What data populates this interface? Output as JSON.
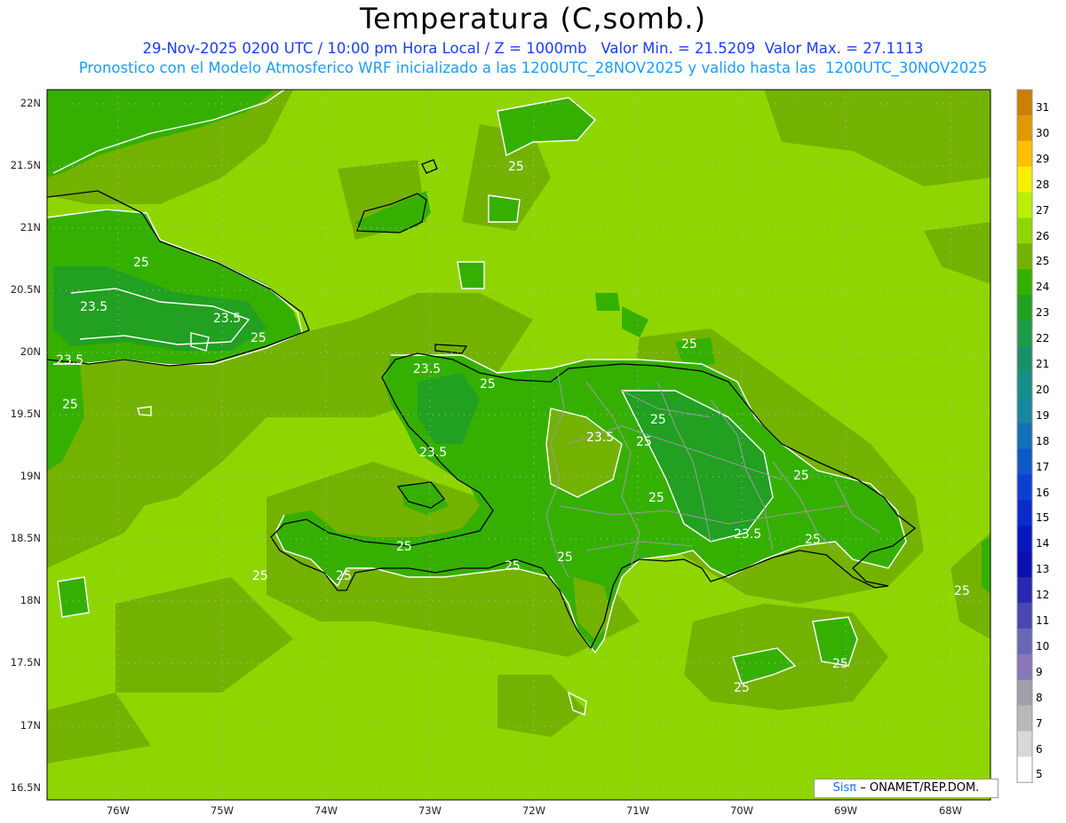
{
  "header": {
    "title": "Temperatura (C,somb.)",
    "line1": "29-Nov-2025 0200 UTC / 10:00 pm Hora Local / Z = 1000mb   Valor Min. = 21.5209  Valor Max. = 27.1113",
    "line2": "Pronostico con el Modelo Atmosferico WRF inicializado a las 1200UTC_28NOV2025 y valido hasta las  1200UTC_30NOV2025"
  },
  "axes": {
    "lat_labels": [
      "22N",
      "21.5N",
      "21N",
      "20.5N",
      "20N",
      "19.5N",
      "19N",
      "18.5N",
      "18N",
      "17.5N",
      "17N",
      "16.5N"
    ],
    "lon_labels": [
      "76W",
      "75W",
      "74W",
      "73W",
      "72W",
      "71W",
      "70W",
      "69W",
      "68W"
    ]
  },
  "colorbar": {
    "labels": [
      "31",
      "30",
      "29",
      "28",
      "27",
      "26",
      "25",
      "24",
      "23",
      "22",
      "21",
      "20",
      "19",
      "18",
      "17",
      "16",
      "15",
      "14",
      "13",
      "12",
      "11",
      "10",
      "9",
      "8",
      "7",
      "6",
      "5"
    ],
    "colors": [
      "#c98000",
      "#e09a00",
      "#ffc000",
      "#f8f000",
      "#b8f000",
      "#8fd600",
      "#74b200",
      "#35b000",
      "#21a021",
      "#1e9a4a",
      "#198f6a",
      "#158f88",
      "#1888a0",
      "#1470b8",
      "#1058c8",
      "#0c40d0",
      "#0a2ccc",
      "#0818c0",
      "#0c10b0",
      "#2828b0",
      "#4848b0",
      "#6868b4",
      "#8878b8",
      "#a0a0a8",
      "#b8b8b8",
      "#d8d8d8",
      "#ffffff"
    ]
  },
  "contour_labels": [
    {
      "text": "25"
    },
    {
      "text": "25"
    },
    {
      "text": "23.5"
    },
    {
      "text": "23.5"
    },
    {
      "text": "25"
    },
    {
      "text": "23.5"
    },
    {
      "text": "25"
    },
    {
      "text": "23.5"
    },
    {
      "text": "25"
    },
    {
      "text": "25"
    },
    {
      "text": "23.5"
    },
    {
      "text": "25"
    },
    {
      "text": "23.5"
    },
    {
      "text": "25"
    },
    {
      "text": "25"
    },
    {
      "text": "25"
    },
    {
      "text": "25"
    },
    {
      "text": "25"
    },
    {
      "text": "25"
    },
    {
      "text": "23.5"
    },
    {
      "text": "25"
    },
    {
      "text": "25"
    },
    {
      "text": "25"
    },
    {
      "text": "25"
    },
    {
      "text": "25"
    },
    {
      "text": "25"
    }
  ],
  "credit": {
    "brand": "Sisπ",
    "text": "– ONAMET/REP.DOM."
  }
}
